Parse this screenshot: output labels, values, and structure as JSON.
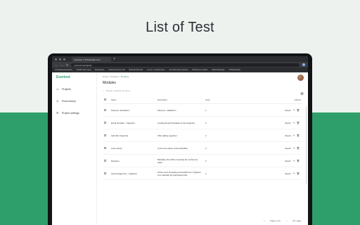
{
  "headline": "List of Test",
  "browser": {
    "tab_title": "Evertest | UI Parandits Cort",
    "url": "evertest.io/projects",
    "bookmarks": [
      "AI Practises/research",
      "AnkiPic Jam Care",
      "Bookmarks",
      "Shasta Premium 3D",
      "Referral SSC Ele",
      "Lucern - Freshservice",
      "All bookmarks research",
      "Rachaunt a Collect",
      "Material Design",
      "All Bookmarks"
    ]
  },
  "sidebar": {
    "logo": "Evertest",
    "items": [
      {
        "label": "Projects",
        "icon": "folder-icon"
      },
      {
        "label": "Runs history",
        "icon": "history-icon"
      },
      {
        "label": "Project settings",
        "icon": "settings-icon"
      }
    ]
  },
  "breadcrumb": {
    "home": "Home",
    "projects": "Projects",
    "current": "Modules",
    "sep": ">"
  },
  "page_title": "Modules",
  "search": {
    "placeholder": "Search modules by name..."
  },
  "table": {
    "headers": [
      "Name",
      "Description",
      "Tests",
      "Actions"
    ],
    "rows": [
      {
        "name": "Payment -all platform",
        "description": "Payment - allplatform",
        "tests": "1",
        "action": "Report"
      },
      {
        "name": "Email Template - Organizer",
        "description": "Creating Email Templates by the Organizer",
        "tests": "2",
        "action": "Report"
      },
      {
        "name": "Add offer Organizer",
        "description": "Offer adding organizer",
        "tests": "2",
        "action": "Report"
      },
      {
        "name": "susan admin",
        "description": "Crumic the admin entire backoffice",
        "tests": "2",
        "action": "Report"
      },
      {
        "name": "Reviewer",
        "description": "Basically who will be reviewing the conference paper",
        "tests": "3",
        "action": "Report"
      },
      {
        "name": "Usermanagement - Organizer",
        "description": "All the users list getting accessible from Organizer end, basically the participants lists",
        "tests": "3",
        "action": "Report"
      }
    ]
  },
  "pager": {
    "page_label": "Page 1 of 2",
    "page_size": "50 / page",
    "prev": "<",
    "next": ">"
  }
}
